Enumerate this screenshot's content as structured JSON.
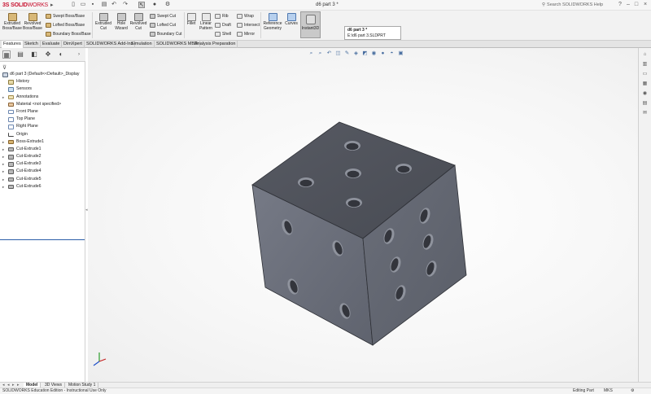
{
  "app": {
    "logo_ds": "3S",
    "logo_solid": "SOLID",
    "logo_works": "WORKS",
    "logo_caret": "▸",
    "document_title": "d6 part 3 *",
    "search_placeholder": "Search SOLIDWORKS Help",
    "search_icon": "search-icon",
    "window_controls": [
      "?",
      "–",
      "□",
      "×"
    ]
  },
  "quick_access": [
    "new-icon",
    "open-icon",
    "save-icon",
    "print-icon",
    "undo-icon",
    "redo-icon",
    "select-icon",
    "rebuild-icon",
    "options-icon"
  ],
  "ribbon": {
    "extruded_boss": "Extruded\nBoss/Base",
    "revolved_boss": "Revolved\nBoss/Base",
    "swept_boss": "Swept Boss/Base",
    "lofted_boss": "Lofted Boss/Base",
    "boundary_boss": "Boundary Boss/Base",
    "extruded_cut": "Extruded\nCut",
    "hole_wizard": "Hole\nWizard",
    "revolved_cut": "Revolved\nCut",
    "swept_cut": "Swept Cut",
    "lofted_cut": "Lofted Cut",
    "boundary_cut": "Boundary Cut",
    "fillet": "Fillet",
    "linear_pattern": "Linear\nPattern",
    "rib": "Rib",
    "draft": "Draft",
    "shell": "Shell",
    "wrap": "Wrap",
    "intersect": "Intersect",
    "mirror": "Mirror",
    "reference_geometry": "Reference\nGeometry",
    "curves": "Curves",
    "instant3d": "Instant3D"
  },
  "tooltip": {
    "title": "d6 part 3 *",
    "path": "E:\\d6 part 3.SLDPRT"
  },
  "tabs": [
    "Features",
    "Sketch",
    "Evaluate",
    "DimXpert",
    "SOLIDWORKS Add-Ins",
    "Simulation",
    "SOLIDWORKS MBD",
    "Analysis Preparation"
  ],
  "feature_manager": {
    "panel_tabs": [
      "feature-manager-icon",
      "property-manager-icon",
      "configuration-manager-icon",
      "dimxpert-manager-icon",
      "display-manager-icon"
    ],
    "filter_icon": "filter-icon",
    "root": "d6 part 3  (Default<<Default>_Display",
    "items": [
      {
        "label": "History",
        "icon": "history-icon",
        "expand": ""
      },
      {
        "label": "Sensors",
        "icon": "sensors-icon",
        "expand": ""
      },
      {
        "label": "Annotations",
        "icon": "annotations-icon",
        "expand": "▸"
      },
      {
        "label": "Material <not specified>",
        "icon": "material-icon",
        "expand": ""
      },
      {
        "label": "Front Plane",
        "icon": "plane-icon",
        "expand": ""
      },
      {
        "label": "Top Plane",
        "icon": "plane-icon",
        "expand": ""
      },
      {
        "label": "Right Plane",
        "icon": "plane-icon",
        "expand": ""
      },
      {
        "label": "Origin",
        "icon": "origin-icon",
        "expand": ""
      },
      {
        "label": "Boss-Extrude1",
        "icon": "boss-extrude-icon",
        "expand": "▸"
      },
      {
        "label": "Cut-Extrude1",
        "icon": "cut-extrude-icon",
        "expand": "▸"
      },
      {
        "label": "Cut-Extrude2",
        "icon": "cut-extrude-icon",
        "expand": "▸"
      },
      {
        "label": "Cut-Extrude3",
        "icon": "cut-extrude-icon",
        "expand": "▸"
      },
      {
        "label": "Cut-Extrude4",
        "icon": "cut-extrude-icon",
        "expand": "▸"
      },
      {
        "label": "Cut-Extrude5",
        "icon": "cut-extrude-icon",
        "expand": "▸"
      },
      {
        "label": "Cut-Extrude6",
        "icon": "cut-extrude-icon",
        "expand": "▸"
      }
    ]
  },
  "heads_up_toolbar": [
    "zoom-to-fit-icon",
    "zoom-area-icon",
    "previous-view-icon",
    "section-view-icon",
    "dynamic-annotation-icon",
    "view-orientation-icon",
    "display-style-icon",
    "hide-show-icon",
    "edit-appearance-icon",
    "scene-icon",
    "view-settings-icon"
  ],
  "model": {
    "description_colors": {
      "top": "#4b4e57",
      "left": "#6a6e7a",
      "right": "#5f636e",
      "hole": "#363840",
      "hole_rim": "#8c909b"
    }
  },
  "bottom_tabs": [
    "Model",
    "3D Views",
    "Motion Study 1"
  ],
  "status": {
    "edition": "SOLIDWORKS Education Edition - Instructional Use Only",
    "mode": "Editing Part",
    "units": "MKS"
  }
}
